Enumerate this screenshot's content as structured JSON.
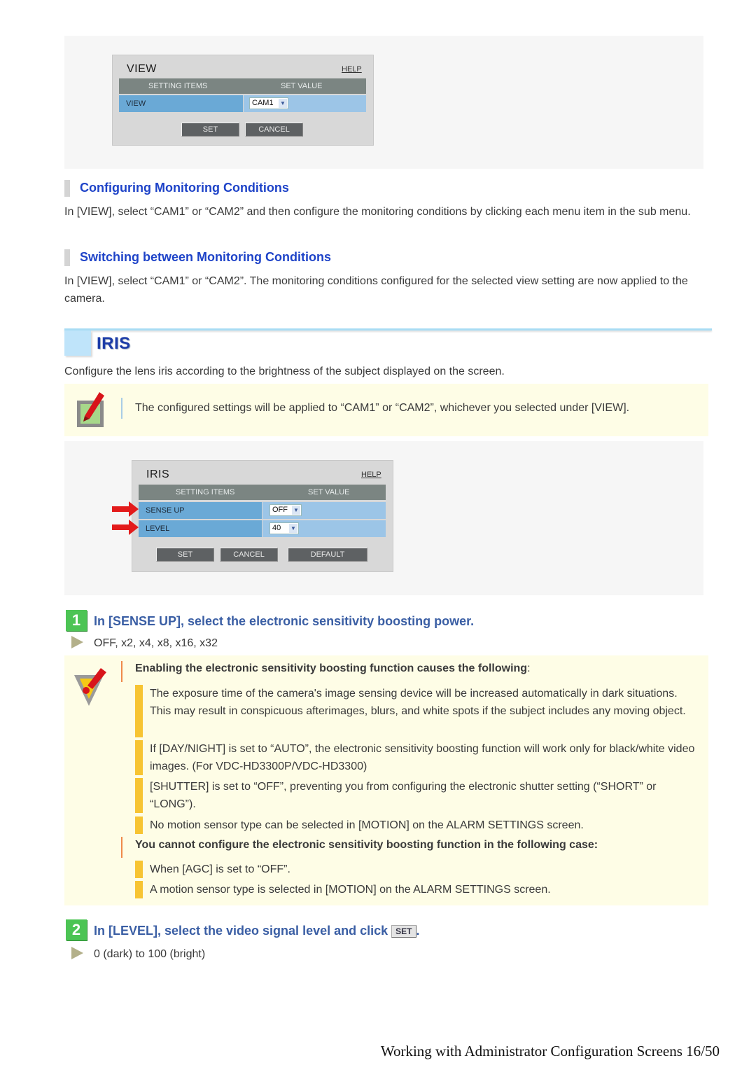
{
  "view_panel": {
    "title": "VIEW",
    "help": "HELP",
    "col_setting_items": "SETTING ITEMS",
    "col_set_value": "SET VALUE",
    "rows": [
      {
        "label": "VIEW",
        "value": "CAM1"
      }
    ],
    "buttons": {
      "set": "SET",
      "cancel": "CANCEL"
    }
  },
  "sections": {
    "configuring": {
      "heading": "Configuring Monitoring Conditions",
      "text": "In [VIEW], select “CAM1” or “CAM2” and then configure the monitoring conditions by clicking each menu item in the sub menu."
    },
    "switching": {
      "heading": "Switching between Monitoring Conditions",
      "text": "In [VIEW], select “CAM1” or “CAM2”. The monitoring conditions configured for the selected view setting are now applied to the camera."
    }
  },
  "iris": {
    "title": "IRIS",
    "intro": "Configure the lens iris according to the brightness of the subject displayed on the screen.",
    "memo": "The configured settings will be applied to “CAM1” or “CAM2”, whichever you selected under [VIEW].",
    "panel": {
      "title": "IRIS",
      "help": "HELP",
      "col_setting_items": "SETTING ITEMS",
      "col_set_value": "SET VALUE",
      "rows": [
        {
          "label": "SENSE UP",
          "value": "OFF"
        },
        {
          "label": "LEVEL",
          "value": "40"
        }
      ],
      "buttons": {
        "set": "SET",
        "cancel": "CANCEL",
        "default": "DEFAULT"
      }
    }
  },
  "steps": [
    {
      "number": "1",
      "text": "In [SENSE UP], select the electronic sensitivity boosting power.",
      "options": "OFF, x2, x4, x8, x16, x32"
    },
    {
      "number": "2",
      "text_before": "In [LEVEL], select the video signal level and click",
      "button_label": "SET",
      "text_after": ".",
      "options": "0 (dark) to 100 (bright)"
    }
  ],
  "caution": {
    "heading1": "Enabling the electronic sensitivity boosting function causes the following",
    "heading1_suffix": ":",
    "items1": [
      "The exposure time of the camera's image sensing device will be increased automatically in dark situations. This may result in conspicuous afterimages, blurs, and white spots if the subject includes any moving object.",
      "If [DAY/NIGHT] is set to “AUTO”, the electronic sensitivity boosting function will work only for black/white video images. (For VDC-HD3300P/VDC-HD3300)",
      "[SHUTTER] is set to “OFF”, preventing you from configuring the electronic shutter setting (“SHORT” or “LONG”).",
      "No motion sensor type can be selected in [MOTION] on the ALARM SETTINGS screen."
    ],
    "heading2": "You cannot configure the electronic sensitivity boosting function in the following case:",
    "items2": [
      "When [AGC] is set to “OFF”.",
      "A motion sensor type is selected in [MOTION] on the ALARM SETTINGS screen."
    ]
  },
  "footer": "Working with Administrator Configuration Screens 16/50"
}
